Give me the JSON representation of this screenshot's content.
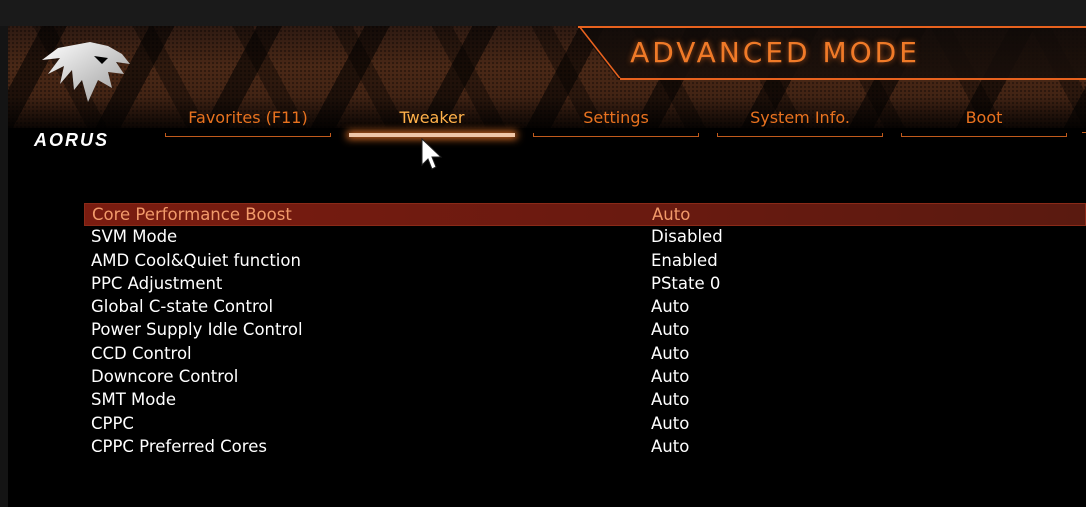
{
  "header": {
    "mode_title": "ADVANCED MODE",
    "brand": "AORUS"
  },
  "tabs": [
    {
      "label": "Favorites (F11)",
      "active": false
    },
    {
      "label": "Tweaker",
      "active": true
    },
    {
      "label": "Settings",
      "active": false
    },
    {
      "label": "System Info.",
      "active": false
    },
    {
      "label": "Boot",
      "active": false
    }
  ],
  "settings": [
    {
      "label": "Core Performance Boost",
      "value": "Auto",
      "selected": true
    },
    {
      "label": "SVM Mode",
      "value": "Disabled"
    },
    {
      "label": "AMD Cool&Quiet function",
      "value": "Enabled"
    },
    {
      "label": "PPC Adjustment",
      "value": "PState 0"
    },
    {
      "label": "Global C-state Control",
      "value": "Auto"
    },
    {
      "label": "Power Supply Idle Control",
      "value": "Auto"
    },
    {
      "label": "CCD Control",
      "value": "Auto"
    },
    {
      "label": "Downcore Control",
      "value": "Auto"
    },
    {
      "label": "SMT Mode",
      "value": "Auto"
    },
    {
      "label": "CPPC",
      "value": "Auto"
    },
    {
      "label": "CPPC Preferred Cores",
      "value": "Auto"
    }
  ],
  "colors": {
    "accent": "#e8721f",
    "active_tab": "#ffb14a",
    "selected_row": "#7a1c10",
    "background": "#000000"
  },
  "icons": {
    "logo": "aorus-eagle-logo",
    "cursor": "mouse-pointer-icon"
  }
}
